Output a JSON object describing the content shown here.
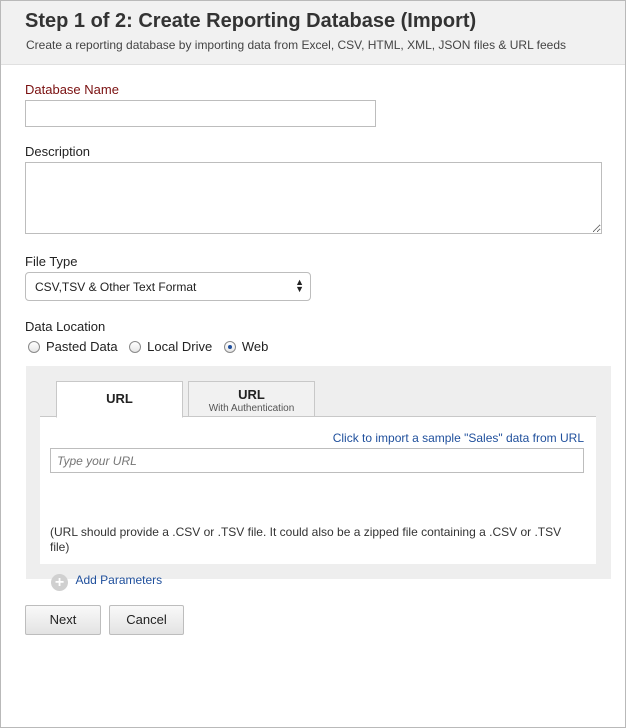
{
  "header": {
    "title": "Step 1 of 2: Create Reporting Database (Import)",
    "subtitle": "Create a reporting database by importing data from Excel, CSV, HTML, XML, JSON files & URL feeds"
  },
  "form": {
    "database_name_label": "Database Name",
    "database_name_value": "",
    "description_label": "Description",
    "description_value": "",
    "file_type_label": "File Type",
    "file_type_selected": "CSV,TSV & Other Text Format",
    "data_location_label": "Data Location",
    "data_location_options": [
      "Pasted Data",
      "Local Drive",
      "Web"
    ],
    "data_location_selected": "Web"
  },
  "tabs": [
    {
      "label": "URL",
      "sublabel": ""
    },
    {
      "label": "URL",
      "sublabel": "With Authentication"
    }
  ],
  "url_tab": {
    "sample_link": "Click to import a sample \"Sales\" data from URL",
    "url_placeholder": "Type your URL",
    "url_value": "",
    "note": "(URL should provide a .CSV or .TSV file. It could also be a zipped file containing a .CSV or .TSV file)",
    "add_parameters": "Add Parameters"
  },
  "buttons": {
    "next": "Next",
    "cancel": "Cancel"
  },
  "colors": {
    "required_label": "#7a1010",
    "link": "#1f4f9c",
    "header_bg": "#f1f1f1"
  }
}
